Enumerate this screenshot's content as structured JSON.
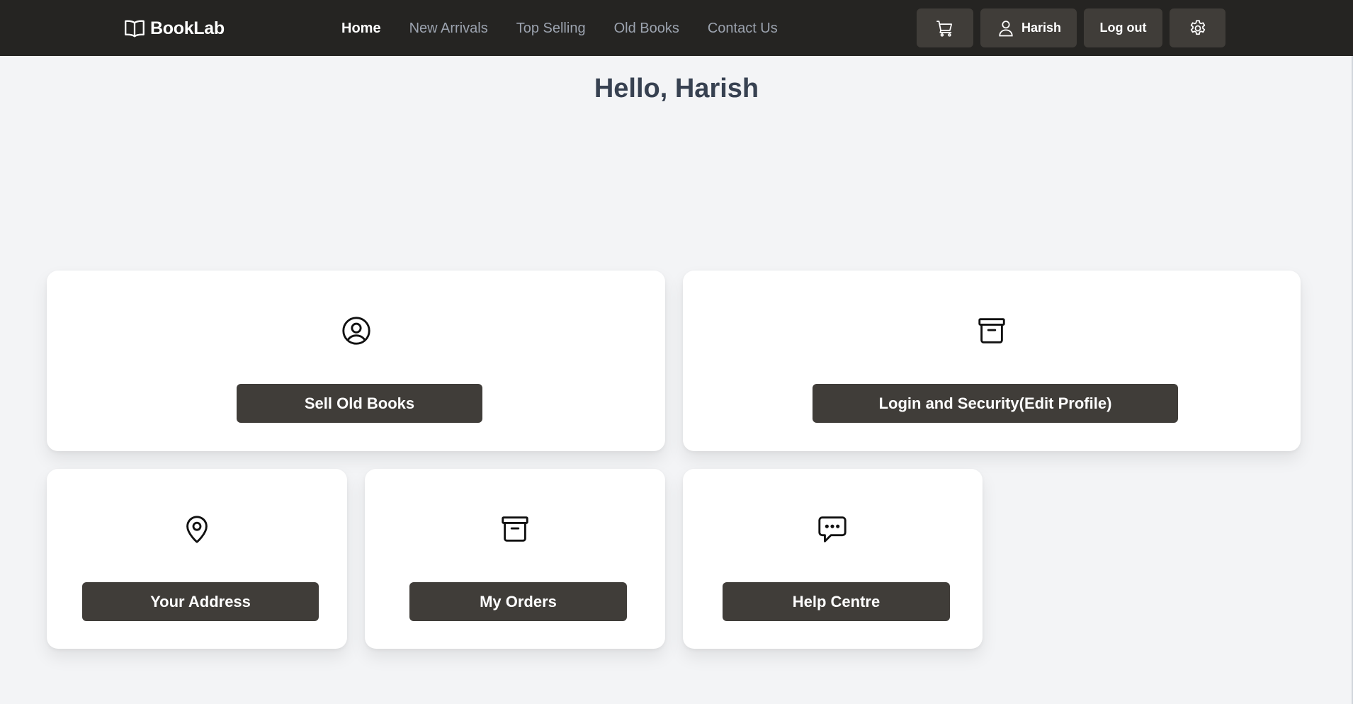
{
  "brand": {
    "name": "BookLab",
    "icon": "book-open-icon"
  },
  "nav": {
    "links": [
      {
        "label": "Home",
        "active": true
      },
      {
        "label": "New Arrivals",
        "active": false
      },
      {
        "label": "Top Selling",
        "active": false
      },
      {
        "label": "Old Books",
        "active": false
      },
      {
        "label": "Contact Us",
        "active": false
      }
    ],
    "cart_icon": "cart-icon",
    "user_label": "Harish",
    "user_icon": "user-icon",
    "logout_label": "Log out",
    "settings_icon": "gear-icon"
  },
  "greeting": "Hello, Harish",
  "cards": [
    {
      "icon": "user-circle-icon",
      "button": "Sell Old Books"
    },
    {
      "icon": "archive-box-icon",
      "button": "Login and Security(Edit Profile)"
    },
    {
      "icon": "map-pin-icon",
      "button": "Your Address"
    },
    {
      "icon": "archive-box-icon",
      "button": "My Orders"
    },
    {
      "icon": "chat-bubble-icon",
      "button": "Help Centre"
    }
  ],
  "colors": {
    "navbar": "#252422",
    "button": "#403d39",
    "background": "#f3f4f6",
    "card": "#ffffff"
  }
}
